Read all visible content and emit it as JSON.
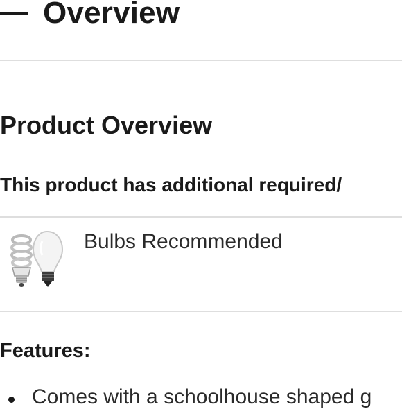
{
  "section": {
    "title": "Overview",
    "collapse_icon": "minus-icon"
  },
  "product": {
    "title": "Product Overview",
    "notice": "This product has additional required/"
  },
  "bulbs": {
    "icon": "light-bulbs-icon",
    "label": "Bulbs Recommended"
  },
  "features": {
    "title": "Features:",
    "items": [
      "Comes with a schoolhouse shaped g"
    ]
  }
}
